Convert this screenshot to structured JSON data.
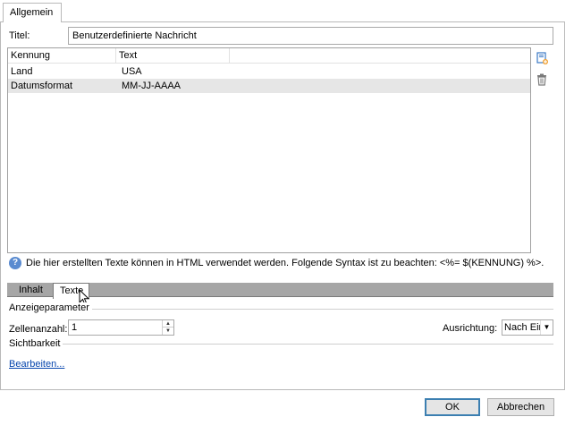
{
  "tabs": {
    "top_tab": "Allgemein"
  },
  "title_field": {
    "label": "Titel:",
    "value": "Benutzerdefinierte Nachricht"
  },
  "list": {
    "columns": [
      "Kennung",
      "Text"
    ],
    "rows": [
      {
        "kennung": "Land",
        "text": "USA"
      },
      {
        "kennung": "Datumsformat",
        "text": "MM-JJ-AAAA"
      }
    ],
    "selected_row": 1
  },
  "side_icons": [
    "add-icon",
    "trash-icon"
  ],
  "info": {
    "icon": "?",
    "text": "Die hier erstellten Texte können in HTML verwendet werden. Folgende Syntax ist zu beachten: <%= $(KENNUNG) %>."
  },
  "bottom_tabs": [
    "Inhalt",
    "Texte"
  ],
  "active_bottom_tab": "Texte",
  "display": {
    "group_label": "Anzeigeparameter",
    "cell_count_label": "Zellenanzahl:",
    "cell_count_value": "1",
    "alignment_label": "Ausrichtung:",
    "alignment_value": "Nach Ein"
  },
  "visibility": {
    "group_label": "Sichtbarkeit",
    "edit_link": "Bearbeiten..."
  },
  "buttons": {
    "ok": "OK",
    "cancel": "Abbrechen"
  },
  "colors": {
    "tabbar": "#a6a6a6",
    "selection": "#e6e6e6",
    "link": "#0645ad",
    "accent": "#3c7fb1"
  }
}
